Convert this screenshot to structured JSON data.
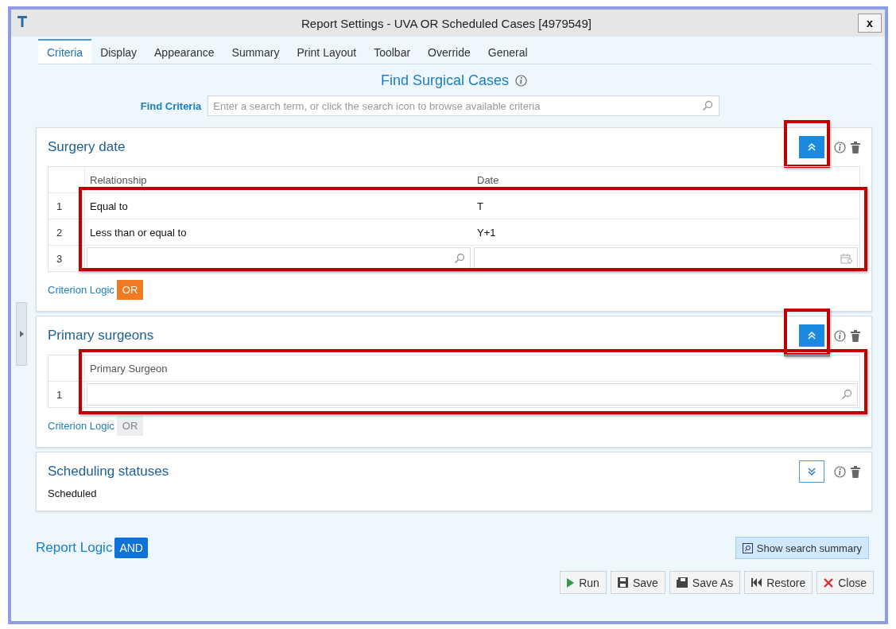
{
  "window": {
    "title": "Report Settings - UVA OR Scheduled Cases [4979549]",
    "close": "x"
  },
  "tabs": [
    {
      "label": "Criteria",
      "selected": true
    },
    {
      "label": "Display",
      "selected": false
    },
    {
      "label": "Appearance",
      "selected": false
    },
    {
      "label": "Summary",
      "selected": false
    },
    {
      "label": "Print Layout",
      "selected": false
    },
    {
      "label": "Toolbar",
      "selected": false
    },
    {
      "label": "Override",
      "selected": false
    },
    {
      "label": "General",
      "selected": false
    }
  ],
  "heading": "Find Surgical Cases",
  "find_criteria": {
    "label": "Find Criteria",
    "placeholder": "Enter a search term, or click the search icon to browse available criteria"
  },
  "criteria": [
    {
      "title": "Surgery date",
      "expanded": true,
      "toggle_highlighted": true,
      "grid_highlighted": true,
      "header_highlighted": false,
      "columns": [
        "Relationship",
        "Date"
      ],
      "rows": [
        {
          "number": "1",
          "cells": [
            "Equal to",
            "T"
          ]
        },
        {
          "number": "2",
          "cells": [
            "Less than or equal to",
            "Y+1"
          ]
        }
      ],
      "entry_row": {
        "number": "3",
        "cells": [
          {
            "kind": "search"
          },
          {
            "kind": "calendar"
          }
        ]
      },
      "logic": {
        "label": "Criterion Logic",
        "value": "OR",
        "on": true
      }
    },
    {
      "title": "Primary surgeons",
      "expanded": true,
      "toggle_highlighted": true,
      "grid_highlighted": true,
      "header_highlighted": true,
      "columns": [
        "Primary Surgeon"
      ],
      "entry_row": {
        "number": "1",
        "cells": [
          {
            "kind": "search"
          }
        ]
      },
      "logic": {
        "label": "Criterion Logic",
        "value": "OR",
        "on": false
      }
    },
    {
      "title": "Scheduling statuses",
      "expanded": false,
      "toggle_highlighted": false,
      "summary": "Scheduled"
    }
  ],
  "report_logic": {
    "label": "Report Logic",
    "value": "AND"
  },
  "summary_button": "Show search summary",
  "buttons": [
    {
      "kind": "run",
      "label": "Run"
    },
    {
      "kind": "save",
      "label": "Save"
    },
    {
      "kind": "saveas",
      "label": "Save As"
    },
    {
      "kind": "restore",
      "label": "Restore"
    },
    {
      "kind": "close",
      "label": "Close"
    }
  ]
}
